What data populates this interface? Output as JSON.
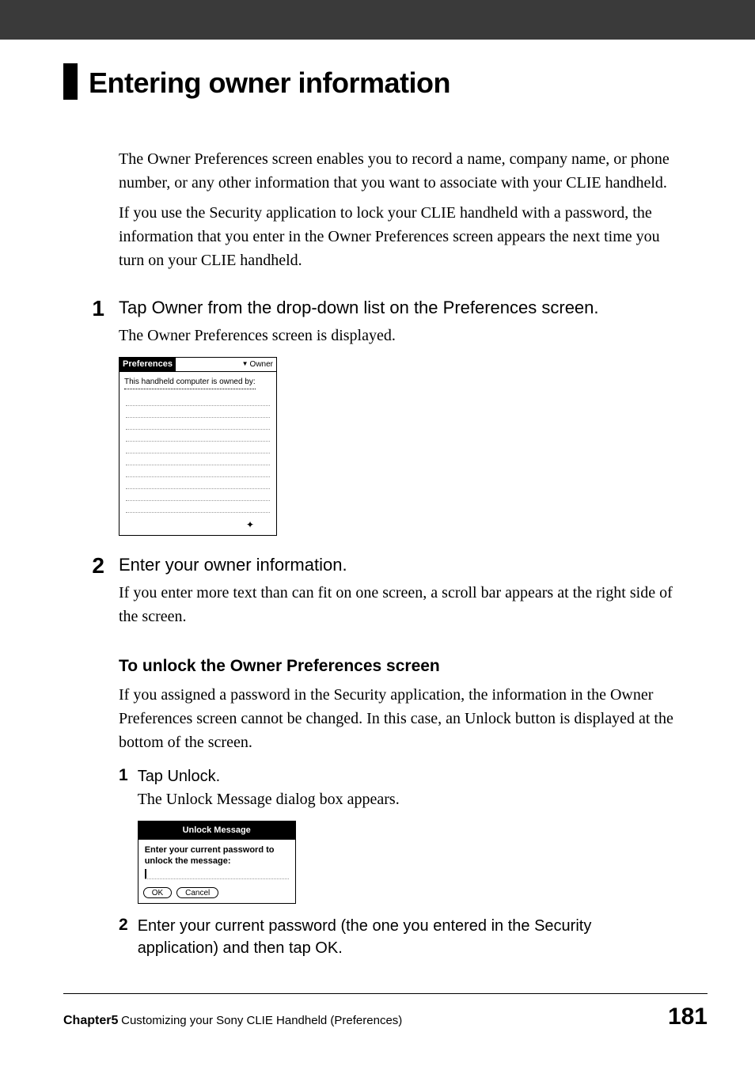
{
  "header": {
    "title": "Entering owner information"
  },
  "intro": {
    "para1": "The Owner Preferences screen enables you to record a name, company name, or phone number, or any other information that you want to associate with your CLIE handheld.",
    "para2": "If you use the Security application to lock your CLIE handheld with a password, the information that you enter in the Owner Preferences screen appears the next time you turn on your CLIE handheld."
  },
  "steps": [
    {
      "num": "1",
      "heading": "Tap Owner from the drop-down list on the Preferences screen.",
      "text": "The Owner Preferences screen is displayed."
    },
    {
      "num": "2",
      "heading": "Enter your owner information.",
      "text": "If you enter more text than can fit on one screen, a scroll bar appears at the right side of the screen."
    }
  ],
  "prefs_shot": {
    "header_left": "Preferences",
    "header_right": "Owner",
    "owned_by": "This handheld computer is owned by:",
    "home_symbol": "⬆"
  },
  "unlock_section": {
    "heading": "To unlock the Owner Preferences screen",
    "para": "If you assigned a password in the Security application, the information in the Owner Preferences screen cannot be changed. In this case, an Unlock button is displayed at the bottom of the screen."
  },
  "sub_steps": [
    {
      "num": "1",
      "heading": "Tap Unlock.",
      "text": "The Unlock Message dialog box appears."
    },
    {
      "num": "2",
      "heading": "Enter your current password (the one you entered in the Security application) and then tap OK.",
      "text": ""
    }
  ],
  "unlock_shot": {
    "title": "Unlock Message",
    "body": "Enter your current password to unlock the message:",
    "ok": "OK",
    "cancel": "Cancel"
  },
  "footer": {
    "chapter": "Chapter5",
    "desc": "Customizing your Sony CLIE Handheld (Preferences)",
    "page": "181"
  }
}
